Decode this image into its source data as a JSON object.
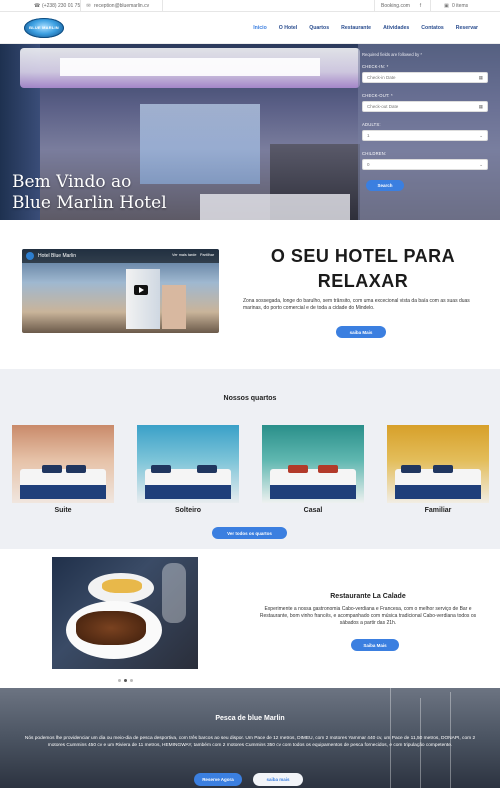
{
  "topbar": {
    "phone": "(+238) 230 01 75",
    "email": "reception@bluemarlin.cv",
    "booking": "Booking.com",
    "facebook_icon": "f",
    "cart": "0 items"
  },
  "nav": {
    "logo_text": "BLUE MARLIN",
    "items": [
      "Inicio",
      "O Hotel",
      "Quartos",
      "Restaurante",
      "Atividades",
      "Contatos",
      "Reservar"
    ]
  },
  "hero": {
    "title_line1": "Bem Vindo ao",
    "title_line2": "Blue Marlin Hotel"
  },
  "booking": {
    "note": "Required fields are followed by *",
    "checkin_label": "CHECK-IN: *",
    "checkin_placeholder": "Check-in Date",
    "checkout_label": "CHECK-OUT: *",
    "checkout_placeholder": "Check-out Date",
    "adults_label": "ADULTS:",
    "adults_value": "1",
    "children_label": "CHILDREN:",
    "children_value": "0",
    "search_label": "Search"
  },
  "intro": {
    "video_title": "Hotel Blue Marlin",
    "video_watch_later": "Ver mais tarde",
    "video_share": "Partilhar",
    "heading": "O SEU HOTEL PARA RELAXAR",
    "text": "Zona sossegada, longe do barulho, sem trânsito, com uma excecional vista da baía com as suas duas marinas, do porto comercial e de toda a cidade do Mindelo.",
    "button": "saiba Mais"
  },
  "rooms": {
    "heading": "Nossos quartos",
    "items": [
      {
        "name": "Suite"
      },
      {
        "name": "Solteiro"
      },
      {
        "name": "Casal"
      },
      {
        "name": "Familiar"
      }
    ],
    "button": "Ver todos os quartos"
  },
  "restaurant": {
    "heading": "Restaurante La Calade",
    "text": "Experimente a nossa gastronomia Cabo-verdiana e Francesa, com o melhor serviço de Bar e Restaurante, bom vinho francês, e acompanhado com música tradicional Cabo-verdiana todos os sábados a partir das 21h.",
    "button": "Saiba Mais"
  },
  "fishing": {
    "heading": "Pesca de blue Marlin",
    "text": "Nós podemos lhe providenciar um dia ou meio-dia de pesca desportiva, com três barcos ao seu dispor. Um Pace de 12 metros, DIMEU, com 2 motores Yammar 440 cv, um Pace de 11,50 metros, DONAPI, com 2 motores Cummins 450 cv e um Riviera de 11 metros, HEMINGWAY, também com 2 motores Cummins 350 cv com todos os equipamentos de pesca fornecidos, e com tripulação competente.",
    "button_primary": "Reserve Agora",
    "button_secondary": "saiba mais"
  },
  "colors": {
    "accent": "#3b7fe0",
    "nav_text": "#2a4d8f",
    "rooms_bg": "#eef0f4"
  }
}
